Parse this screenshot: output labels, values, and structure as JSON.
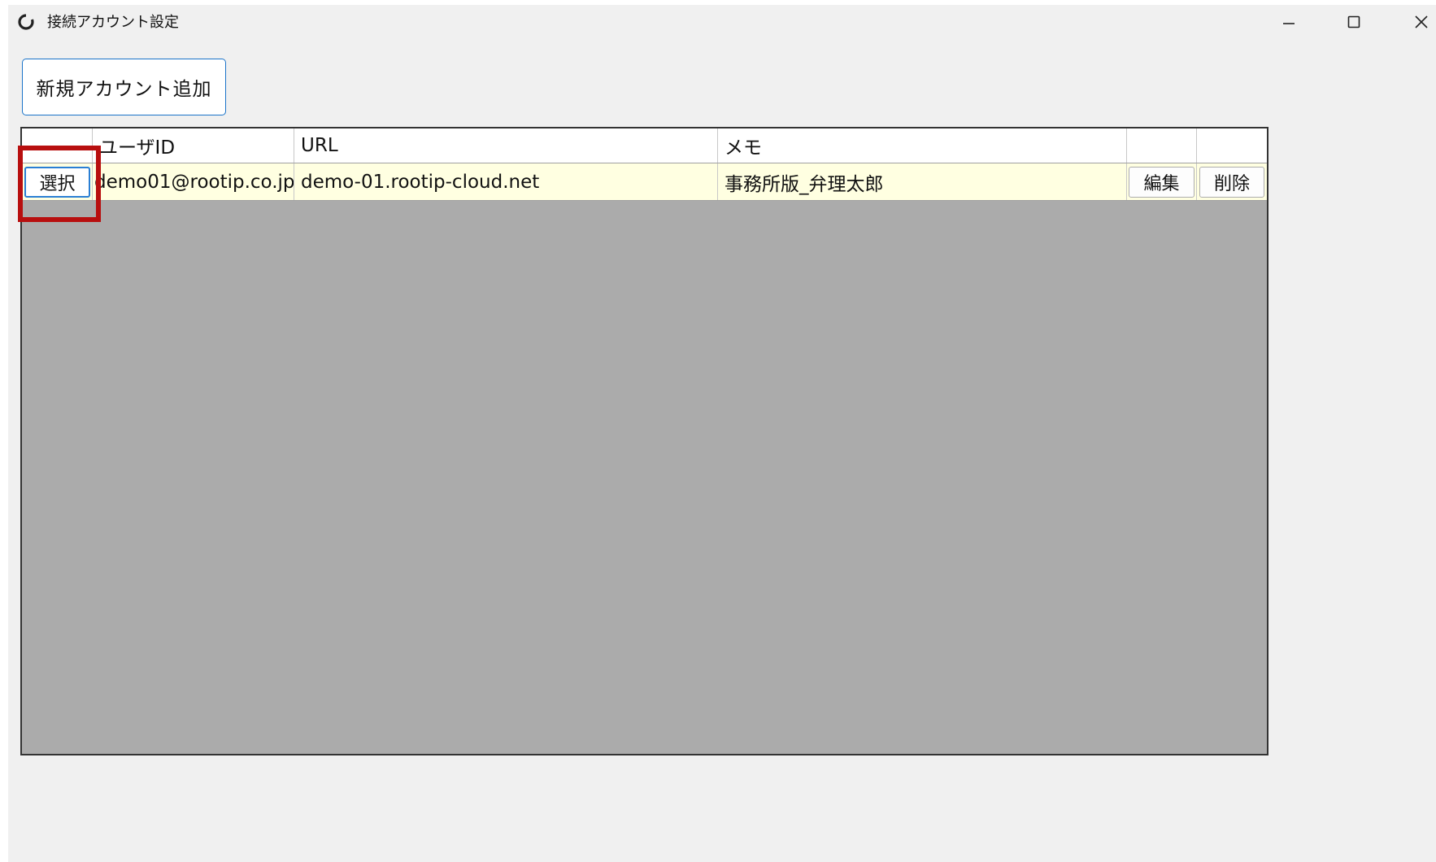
{
  "window": {
    "title": "接続アカウント設定",
    "controls": {
      "minimize_icon": "minimize-icon",
      "maximize_icon": "maximize-icon",
      "close_icon": "close-icon"
    }
  },
  "toolbar": {
    "add_account_label": "新規アカウント追加"
  },
  "grid": {
    "columns": [
      "",
      "ユーザID",
      "URL",
      "メモ",
      "",
      ""
    ],
    "rows": [
      {
        "select_label": "選択",
        "user_id": "demo01@rootip.co.jp",
        "url": "demo-01.rootip-cloud.net",
        "memo": "事務所版_弁理太郎",
        "edit_label": "編集",
        "delete_label": "削除"
      }
    ]
  },
  "colors": {
    "selected_row_bg": "#ffffe1",
    "grid_empty_bg": "#ababab",
    "highlight_border": "#b80f0f",
    "accent_border": "#1a73c9"
  }
}
